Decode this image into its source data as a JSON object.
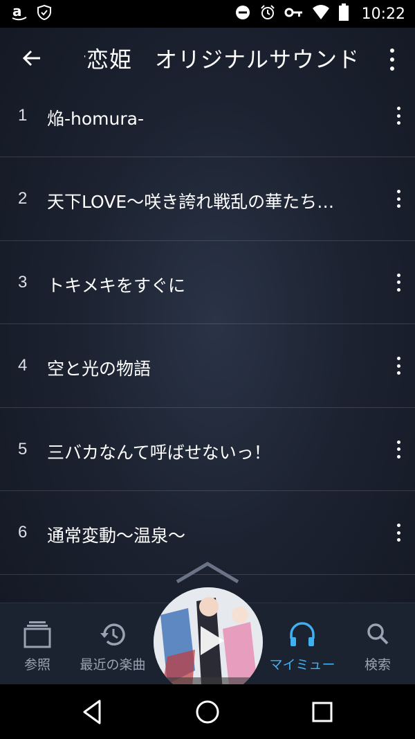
{
  "status_bar": {
    "time": "10:22",
    "left_icons": [
      "amazon-icon",
      "shield-icon"
    ],
    "right_icons": [
      "dnd-icon",
      "alarm-icon",
      "key-icon",
      "wifi-icon",
      "battery-icon"
    ]
  },
  "header": {
    "title": "†恋姫　オリジナルサウンドトラック"
  },
  "tracks": [
    {
      "num": "1",
      "title": "焔-homura-"
    },
    {
      "num": "2",
      "title": "天下LOVE～咲き誇れ戦乱の華たち…"
    },
    {
      "num": "3",
      "title": "トキメキをすぐに"
    },
    {
      "num": "4",
      "title": "空と光の物語"
    },
    {
      "num": "5",
      "title": "三バカなんて呼ばせないっ！"
    },
    {
      "num": "6",
      "title": "通常変動～温泉～"
    }
  ],
  "bottom_nav": {
    "browse": "参照",
    "recent": "最近の楽曲",
    "my_music": "マイミュー",
    "search": "検索"
  },
  "colors": {
    "accent": "#3fb1f0",
    "nav_bg": "#1b2230",
    "list_bg": "#1c2230"
  }
}
